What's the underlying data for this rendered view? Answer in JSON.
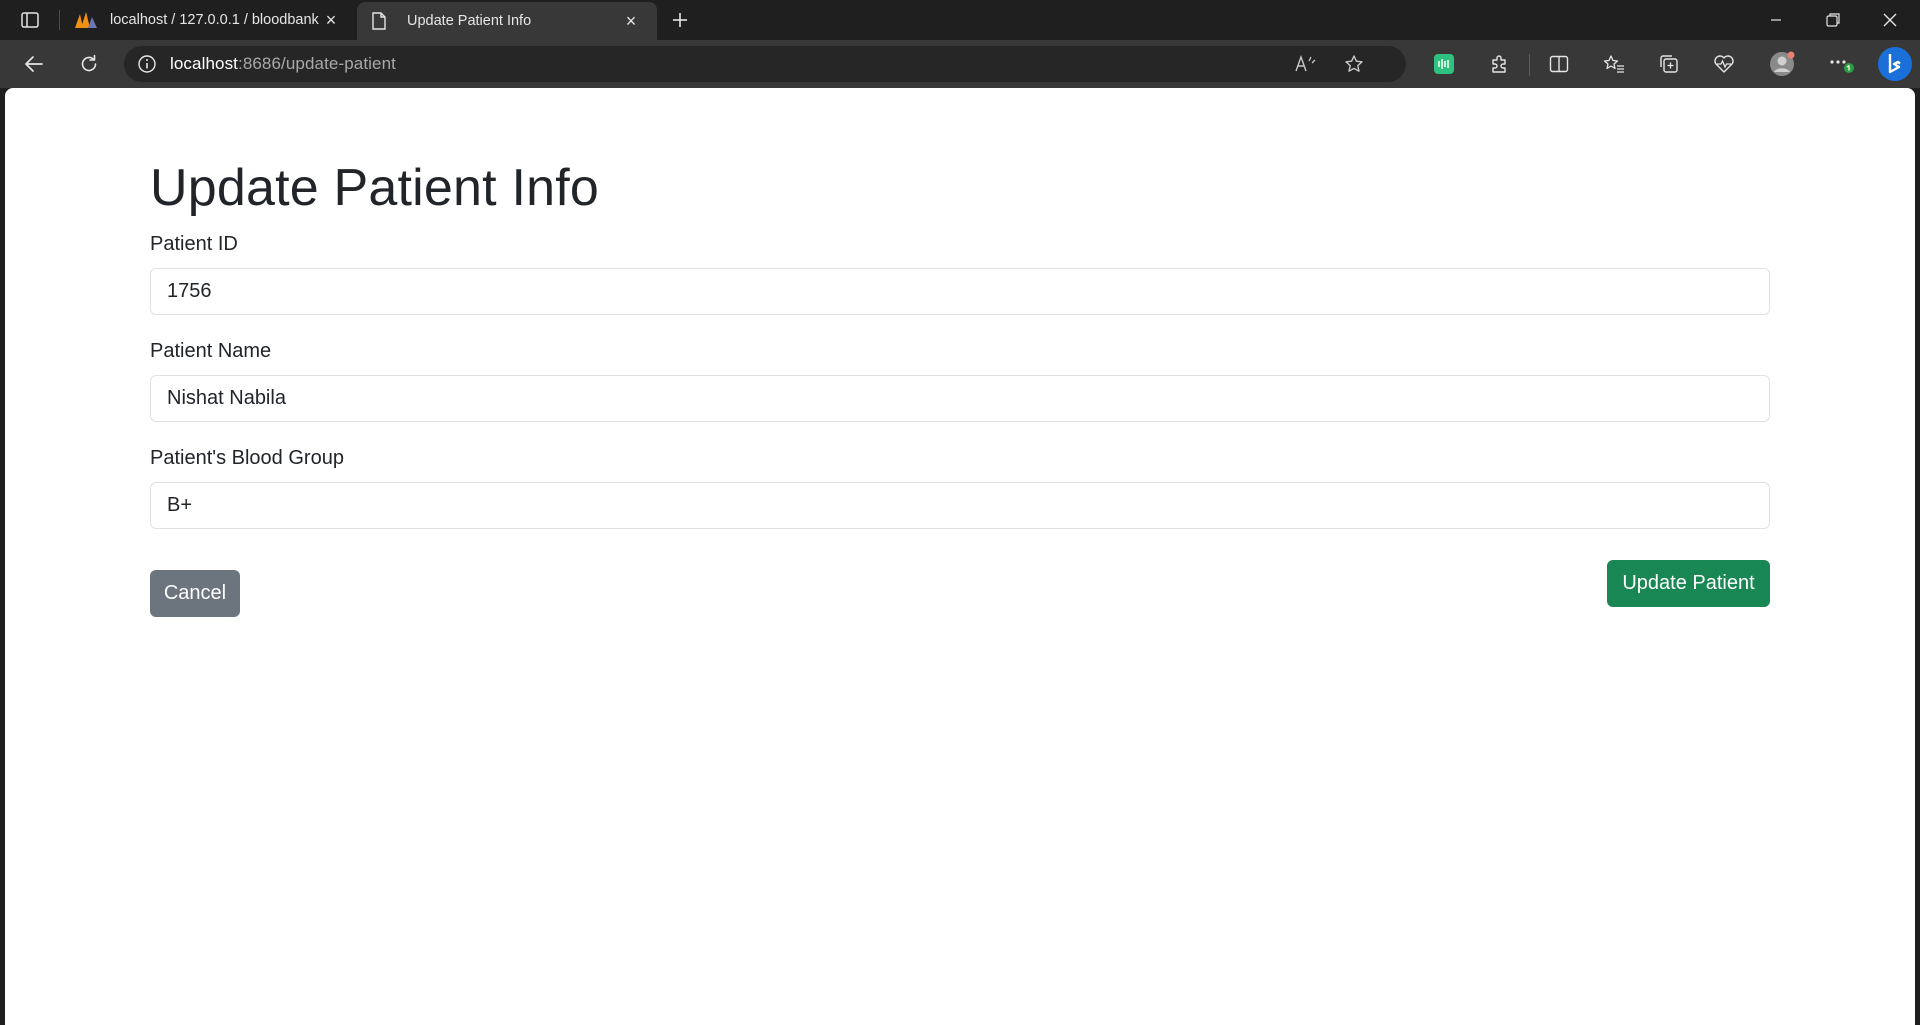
{
  "browser": {
    "tabs": [
      {
        "label": "localhost / 127.0.0.1 / bloodbank",
        "active": false
      },
      {
        "label": "Update Patient Info",
        "active": true
      }
    ],
    "address": {
      "host": "localhost",
      "path": ":8686/update-patient"
    }
  },
  "page": {
    "title": "Update Patient Info",
    "fields": [
      {
        "label": "Patient ID",
        "value": "1756"
      },
      {
        "label": "Patient Name",
        "value": "Nishat Nabila"
      },
      {
        "label": "Patient's Blood Group",
        "value": "B+"
      }
    ],
    "cancel_label": "Cancel",
    "submit_label": "Update Patient"
  },
  "colors": {
    "primary_button": "#198754",
    "secondary_button": "#6c757d",
    "chrome_dark": "#1f1f1f",
    "chrome_toolbar": "#383838"
  }
}
